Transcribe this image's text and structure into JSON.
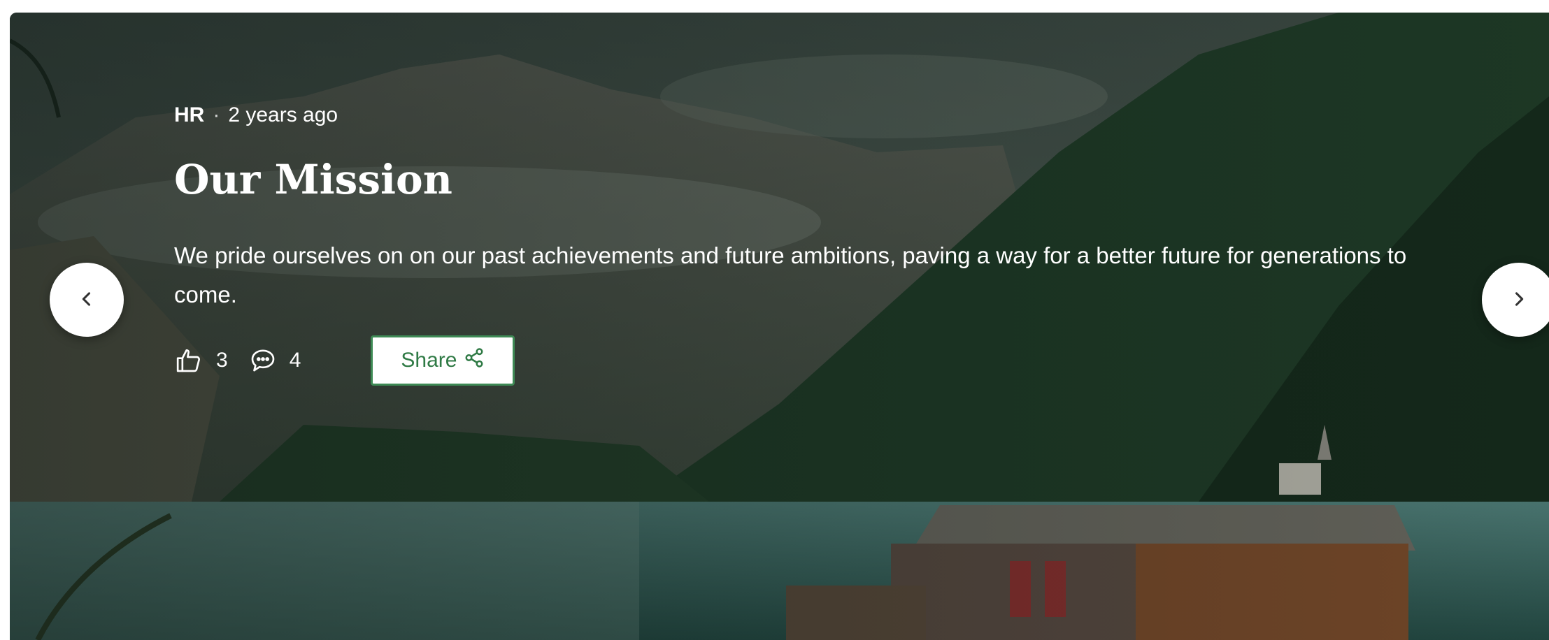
{
  "post": {
    "author": "HR",
    "separator": "·",
    "time": "2 years ago",
    "title": "Our Mission",
    "description": "We pride ourselves on on our past achievements and future ambitions, paving a way for a better future for generations to come.",
    "likes": "3",
    "comments": "4",
    "share_label": "Share"
  },
  "icons": {
    "like": "thumbs-up-icon",
    "comment": "speech-bubble-icon",
    "share": "share-nodes-icon",
    "prev": "chevron-left-icon",
    "next": "chevron-right-icon"
  },
  "colors": {
    "accent": "#2f7a45",
    "button_border": "#3e8a55",
    "text": "#ffffff"
  }
}
